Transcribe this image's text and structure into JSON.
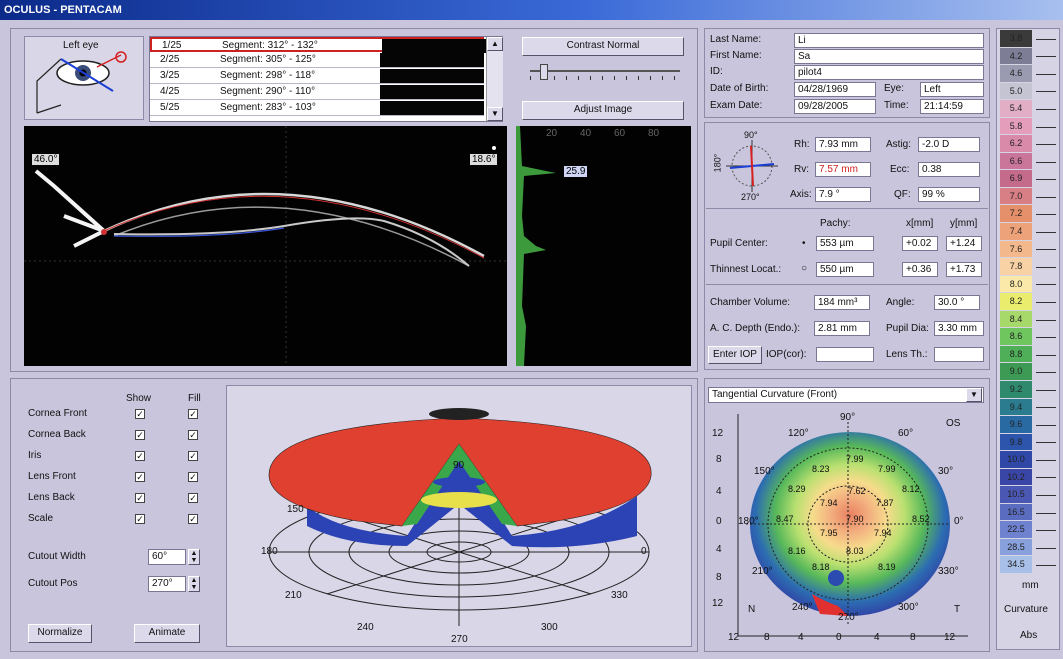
{
  "window": {
    "title": "OCULUS - PENTACAM"
  },
  "eye_selector": {
    "label": "Left eye"
  },
  "segments": [
    {
      "num": "1/25",
      "label": "Segment: 312° - 132°"
    },
    {
      "num": "2/25",
      "label": "Segment: 305° - 125°"
    },
    {
      "num": "3/25",
      "label": "Segment: 298° - 118°"
    },
    {
      "num": "4/25",
      "label": "Segment: 290° - 110°"
    },
    {
      "num": "5/25",
      "label": "Segment: 283° - 103°"
    }
  ],
  "image_controls": {
    "contrast_label": "Contrast Normal",
    "adjust_label": "Adjust Image"
  },
  "scheimpflug": {
    "left_angle": "46.0°",
    "right_angle": "18.6°"
  },
  "densitometry": {
    "ticks": [
      "20",
      "40",
      "60",
      "80"
    ],
    "value": "25.9"
  },
  "patient": {
    "last_name_label": "Last Name:",
    "last_name": "Li",
    "first_name_label": "First Name:",
    "first_name": "Sa",
    "id_label": "ID:",
    "id": "pilot4",
    "dob_label": "Date of Birth:",
    "dob": "04/28/1969",
    "eye_label": "Eye:",
    "eye": "Left",
    "exam_date_label": "Exam Date:",
    "exam_date": "09/28/2005",
    "time_label": "Time:",
    "time": "21:14:59"
  },
  "keratometry": {
    "compass": {
      "top": "90°",
      "bottom": "270°",
      "left": "180°"
    },
    "rh_label": "Rh:",
    "rh": "7.93 mm",
    "rv_label": "Rv:",
    "rv": "7.57 mm",
    "axis_label": "Axis:",
    "axis": "7.9 °",
    "astig_label": "Astig:",
    "astig": "-2.0 D",
    "ecc_label": "Ecc:",
    "ecc": "0.38",
    "qf_label": "QF:",
    "qf": "99 %",
    "pachy_header": "Pachy:",
    "x_header": "x[mm]",
    "y_header": "y[mm]",
    "pupil_center_label": "Pupil Center:",
    "pupil_center_pachy": "553 µm",
    "pupil_center_x": "+0.02",
    "pupil_center_y": "+1.24",
    "thinnest_label": "Thinnest Locat.:",
    "thinnest_pachy": "550 µm",
    "thinnest_x": "+0.36",
    "thinnest_y": "+1.73",
    "chamber_volume_label": "Chamber Volume:",
    "chamber_volume": "184 mm³",
    "angle_label": "Angle:",
    "angle": "30.0 °",
    "ac_depth_label": "A. C. Depth (Endo.):",
    "ac_depth": "2.81 mm",
    "pupil_dia_label": "Pupil Dia:",
    "pupil_dia": "3.30 mm",
    "enter_iop_label": "Enter IOP",
    "iop_cor_label": "IOP(cor):",
    "iop_cor": "",
    "lens_th_label": "Lens Th.:",
    "lens_th": ""
  },
  "display_options": {
    "show_header": "Show",
    "fill_header": "Fill",
    "rows": [
      "Cornea Front",
      "Cornea Back",
      "Iris",
      "Lens Front",
      "Lens Back",
      "Scale"
    ],
    "cutout_width_label": "Cutout Width",
    "cutout_width": "60°",
    "cutout_pos_label": "Cutout Pos",
    "cutout_pos": "270°",
    "normalize_label": "Normalize",
    "animate_label": "Animate"
  },
  "model3d": {
    "labels": {
      "a90": "90",
      "a150": "150",
      "a180": "180",
      "a0": "0",
      "a210": "210",
      "a330": "330",
      "a240": "240",
      "a300": "300",
      "a270": "270"
    }
  },
  "topo_map": {
    "dropdown": "Tangential Curvature (Front)",
    "eye": "OS",
    "y_ticks": [
      "12",
      "8",
      "4",
      "0",
      "4",
      "8",
      "12"
    ],
    "x_ticks": [
      "12",
      "8",
      "4",
      "0",
      "4",
      "8",
      "12"
    ],
    "corner_left": "N",
    "corner_right": "T",
    "angle_labels": [
      "90°",
      "120°",
      "60°",
      "150°",
      "30°",
      "180°",
      "0°",
      "210°",
      "330°",
      "240°",
      "300°",
      "270°"
    ],
    "values": [
      "7.99",
      "8.23",
      "7.99",
      "8.29",
      "8.12",
      "7.94",
      "7.62",
      "7.87",
      "8.47",
      "7.90",
      "8.52",
      "7.95",
      "7.94",
      "8.16",
      "8.03",
      "8.18",
      "8.19"
    ]
  },
  "color_scale": {
    "values": [
      "3.8",
      "4.2",
      "4.6",
      "5.0",
      "5.4",
      "5.8",
      "6.2",
      "6.6",
      "6.9",
      "7.0",
      "7.2",
      "7.4",
      "7.6",
      "7.8",
      "8.0",
      "8.2",
      "8.4",
      "8.6",
      "8.8",
      "9.0",
      "9.2",
      "9.4",
      "9.6",
      "9.8",
      "10.0",
      "10.2",
      "10.5",
      "16.5",
      "22.5",
      "28.5",
      "34.5"
    ],
    "colors": [
      "#3a3a3a",
      "#7d7d96",
      "#9a9ab0",
      "#c4c4d2",
      "#e2aec6",
      "#e49dbb",
      "#d98aa8",
      "#c9769a",
      "#c46a8b",
      "#d87f86",
      "#e5906a",
      "#eea27a",
      "#f3b98d",
      "#f8d2a4",
      "#fae9a8",
      "#e9ec6c",
      "#a7d86a",
      "#6fc65f",
      "#4faf58",
      "#3c9a54",
      "#2f8a6d",
      "#2b7c8f",
      "#296aa3",
      "#2c55ab",
      "#2f48a8",
      "#3a46a6",
      "#4a58b4",
      "#5a6cc0",
      "#6e82cf",
      "#88a0dc",
      "#a8bfe8"
    ],
    "unit": "mm",
    "type": "Curvature",
    "mode": "Abs"
  }
}
